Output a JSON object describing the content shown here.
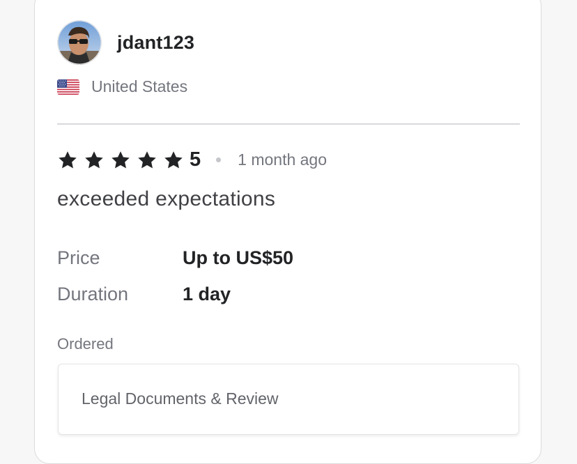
{
  "reviewer": {
    "username": "jdant123",
    "country": "United States",
    "flag_icon": "us-flag-icon"
  },
  "review": {
    "rating": "5",
    "stars_filled": 5,
    "stars_total": 5,
    "time_ago": "1 month ago",
    "text": "exceeded expectations"
  },
  "details": {
    "price_label": "Price",
    "price_value": "Up to US$50",
    "duration_label": "Duration",
    "duration_value": "1 day"
  },
  "ordered": {
    "label": "Ordered",
    "item": "Legal Documents & Review"
  },
  "colors": {
    "star": "#222325",
    "muted_text": "#74767e",
    "primary_text": "#222325"
  }
}
